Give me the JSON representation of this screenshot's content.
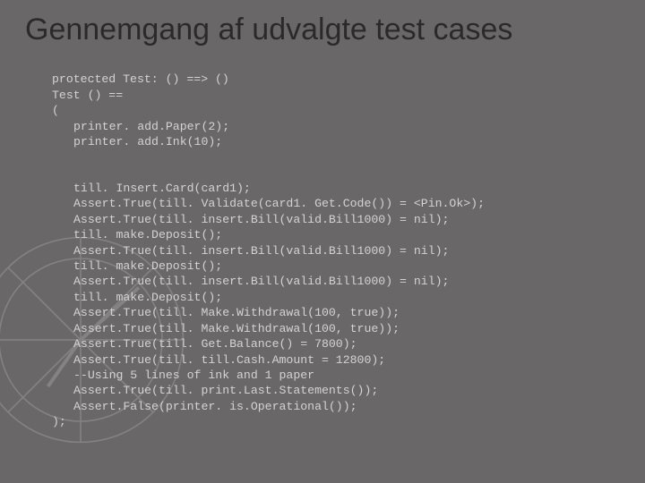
{
  "title": "Gennemgang af udvalgte test cases",
  "code": {
    "l0": "protected Test: () ==> ()",
    "l1": "Test () ==",
    "l2": "(",
    "l3": "printer. add.Paper(2);",
    "l4": "printer. add.Ink(10);",
    "l5": "till. Insert.Card(card1);",
    "l6": "Assert.True(till. Validate(card1. Get.Code()) = <Pin.Ok>);",
    "l7": "Assert.True(till. insert.Bill(valid.Bill1000) = nil);",
    "l8": "till. make.Deposit();",
    "l9": "Assert.True(till. insert.Bill(valid.Bill1000) = nil);",
    "l10": "till. make.Deposit();",
    "l11": "Assert.True(till. insert.Bill(valid.Bill1000) = nil);",
    "l12": "till. make.Deposit();",
    "l13": "Assert.True(till. Make.Withdrawal(100, true));",
    "l14": "Assert.True(till. Make.Withdrawal(100, true));",
    "l15": "Assert.True(till. Get.Balance() = 7800);",
    "l16": "Assert.True(till. till.Cash.Amount = 12800);",
    "l17": "--Using 5 lines of ink and 1 paper",
    "l18": "Assert.True(till. print.Last.Statements());",
    "l19": "Assert.False(printer. is.Operational());",
    "l20": ");"
  }
}
